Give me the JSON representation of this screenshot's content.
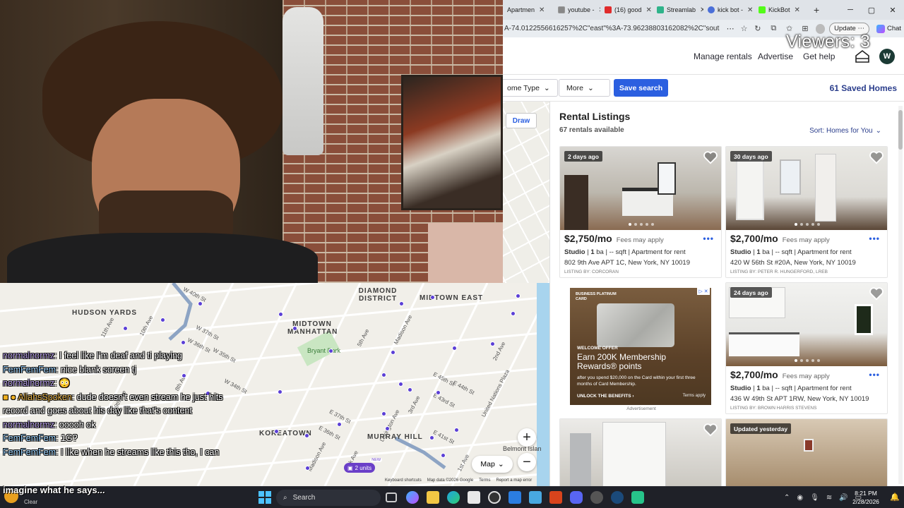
{
  "browser": {
    "tabs": [
      {
        "label": "Apartmen",
        "color": "#2b5fe0"
      },
      {
        "label": "youtube -",
        "color": "#888888"
      },
      {
        "label": "(16) good",
        "color": "#e02b2b"
      },
      {
        "label": "Streamlab",
        "color": "#2fb38a"
      },
      {
        "label": "kick bot -",
        "color": "#4a6fd8"
      },
      {
        "label": "KickBot",
        "color": "#53fc18"
      }
    ],
    "url": "A-74.0122556616257%2C\"east\"%3A-73.96238803162082%2C\"south\"%3A4...",
    "update_label": "Update",
    "chat_label": "Chat"
  },
  "site": {
    "nav": [
      "Manage rentals",
      "Advertise",
      "Get help"
    ],
    "avatar_initial": "W",
    "filters": {
      "home_type_label": "ome Type",
      "more_label": "More",
      "save_search_label": "Save search",
      "saved_homes": "61 Saved Homes"
    },
    "draw_label": "Draw",
    "listings_title": "Rental Listings",
    "listings_count": "67 rentals available",
    "sort_label": "Sort: Homes for You"
  },
  "listings": [
    {
      "badge": "2 days ago",
      "price": "$2,750/mo",
      "fees": "Fees may apply",
      "type": "Studio",
      "baths": "1",
      "specs_rest": "ba | -- sqft | Apartment for rent",
      "address": "802 9th Ave APT 1C, New York, NY 10019",
      "listing_by": "LISTING BY: CORCORAN"
    },
    {
      "badge": "30 days ago",
      "price": "$2,700/mo",
      "fees": "Fees may apply",
      "type": "Studio",
      "baths": "1",
      "specs_rest": "ba | -- sqft | Apartment for rent",
      "address": "420 W 56th St #20A, New York, NY 10019",
      "listing_by": "LISTING BY: PETER R. HUNGERFORD, LREB"
    },
    {
      "badge": "24 days ago",
      "price": "$2,700/mo",
      "fees": "Fees may apply",
      "type": "Studio",
      "baths": "1",
      "specs_rest": "ba | -- sqft | Apartment for rent",
      "address": "436 W 49th St APT 1RW, New York, NY 10019",
      "listing_by": "LISTING BY: BROWN HARRIS STEVENS"
    },
    {
      "badge": "",
      "price": "",
      "fees": "",
      "type": "",
      "baths": "",
      "specs_rest": "",
      "address": "",
      "listing_by": ""
    },
    {
      "badge": "Updated yesterday",
      "price": "",
      "fees": "",
      "type": "",
      "baths": "",
      "specs_rest": "",
      "address": "",
      "listing_by": ""
    }
  ],
  "ad": {
    "brand": "BUSINESS PLATINUM CARD",
    "offer": "WELCOME OFFER",
    "headline": "Earn 200K Membership Rewards® points",
    "fine_print": "after you spend $20,000 on the Card within your first three months of Card Membership.",
    "cta": "UNLOCK THE BENEFITS ›",
    "terms": "Terms apply",
    "label": "Advertisement"
  },
  "stream": {
    "viewers": "Viewers: 3",
    "chat": [
      {
        "user": "normalnormz",
        "text": "I feel like I'm deaf and ti playing"
      },
      {
        "user": "FemFemFem",
        "text": "nice blank screen tj"
      },
      {
        "user": "normalnormz",
        "text": "😳"
      },
      {
        "user": "AliahsSpoken",
        "text": "dude doesn't even stream he just hits"
      },
      {
        "user": "",
        "text": "record and goes about his day like that's content"
      },
      {
        "user": "normalnormz",
        "text": "ooooh ok"
      },
      {
        "user": "FemFemFem",
        "text": "1G?"
      },
      {
        "user": "FemFemFem",
        "text": "I like when he streams like this tho, I can"
      }
    ],
    "bottom_caption": "imagine what he says..."
  },
  "map": {
    "labels": [
      "HUDSON YARDS",
      "DIAMOND DISTRICT",
      "MIDTOWN EAST",
      "MIDTOWN MANHATTAN",
      "Bryant Park",
      "KOREATOWN",
      "MURRAY HILL",
      "Belmont Islan"
    ],
    "streets": [
      "11th Ave",
      "10th Ave",
      "W 40th St",
      "W 37th St",
      "W 36th St",
      "W 35th St",
      "W 34th St",
      "E 45th St",
      "E 44th St",
      "E 43rd St",
      "E 41st St",
      "E 37th St",
      "E 36th St",
      "Park Ave",
      "Lexington Ave",
      "Madison Ave",
      "2nd Ave",
      "3rd Ave",
      "1st Ave",
      "United Nations Plaza",
      "Madison Ave",
      "5th Ave",
      "8th Ave",
      "9th Ave"
    ],
    "map_type_label": "Map",
    "units_label": "2 units",
    "new_label": "NEW",
    "footer": [
      "Keyboard shortcuts",
      "Map data ©2026 Google",
      "Terms",
      "Report a map error"
    ]
  },
  "taskbar": {
    "weather": "Clear",
    "search_label": "Search",
    "time": "8:21 PM",
    "date": "2/28/2026"
  },
  "colors": {
    "accent": "#2b5fe0",
    "title_blue": "#2b3e8c",
    "pin_purple": "#5b3fd6"
  }
}
